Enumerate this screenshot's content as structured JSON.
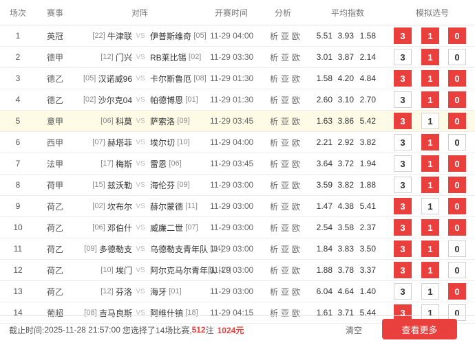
{
  "headers": {
    "num": "场次",
    "league": "赛事",
    "match": "对阵",
    "time": "开赛时间",
    "analysis": "分析",
    "odds": "平均指数",
    "sim": "模拟选号"
  },
  "analysis_links": [
    "析",
    "亚",
    "欧"
  ],
  "vs_label": "VS",
  "matches": [
    {
      "num": "1",
      "league": "英冠",
      "home_rank": "[22]",
      "home": "牛津联",
      "away": "伊普斯维奇",
      "away_rank": "[05]",
      "time": "11-29 04:00",
      "odds": [
        "5.51",
        "3.93",
        "1.58"
      ],
      "sel3": true,
      "sel1": true,
      "sel0": true
    },
    {
      "num": "2",
      "league": "德甲",
      "home_rank": "[12]",
      "home": "门兴",
      "away": "RB莱比锡",
      "away_rank": "[02]",
      "time": "11-29 03:30",
      "odds": [
        "3.01",
        "3.87",
        "2.14"
      ],
      "sel3": false,
      "sel1": true,
      "sel0": false
    },
    {
      "num": "3",
      "league": "德乙",
      "home_rank": "[05]",
      "home": "汉诺威96",
      "away": "卡尔斯鲁厄",
      "away_rank": "[08]",
      "time": "11-29 01:30",
      "odds": [
        "1.58",
        "4.20",
        "4.84"
      ],
      "sel3": true,
      "sel1": true,
      "sel0": true
    },
    {
      "num": "4",
      "league": "德乙",
      "home_rank": "[02]",
      "home": "沙尔克04",
      "away": "帕德博恩",
      "away_rank": "[01]",
      "time": "11-29 01:30",
      "odds": [
        "2.60",
        "3.10",
        "2.70"
      ],
      "sel3": false,
      "sel1": true,
      "sel0": true
    },
    {
      "num": "5",
      "league": "意甲",
      "home_rank": "[06]",
      "home": "科莫",
      "away": "萨索洛",
      "away_rank": "[09]",
      "time": "11-29 03:45",
      "odds": [
        "1.63",
        "3.86",
        "5.42"
      ],
      "sel3": true,
      "sel1": false,
      "sel0": true
    },
    {
      "num": "6",
      "league": "西甲",
      "home_rank": "[07]",
      "home": "赫塔菲",
      "away": "埃尔切",
      "away_rank": "[10]",
      "time": "11-29 04:00",
      "odds": [
        "2.21",
        "2.92",
        "3.82"
      ],
      "sel3": false,
      "sel1": true,
      "sel0": false
    },
    {
      "num": "7",
      "league": "法甲",
      "home_rank": "[17]",
      "home": "梅斯",
      "away": "雷恩",
      "away_rank": "[06]",
      "time": "11-29 03:45",
      "odds": [
        "3.64",
        "3.72",
        "1.94"
      ],
      "sel3": false,
      "sel1": true,
      "sel0": true
    },
    {
      "num": "8",
      "league": "荷甲",
      "home_rank": "[15]",
      "home": "兹沃勒",
      "away": "海伦芬",
      "away_rank": "[09]",
      "time": "11-29 03:00",
      "odds": [
        "3.59",
        "3.82",
        "1.88"
      ],
      "sel3": false,
      "sel1": true,
      "sel0": true
    },
    {
      "num": "9",
      "league": "荷乙",
      "home_rank": "[02]",
      "home": "坎布尔",
      "away": "赫尔蒙德",
      "away_rank": "[11]",
      "time": "11-29 03:00",
      "odds": [
        "1.47",
        "4.38",
        "5.41"
      ],
      "sel3": true,
      "sel1": false,
      "sel0": true
    },
    {
      "num": "10",
      "league": "荷乙",
      "home_rank": "[06]",
      "home": "邓伯什",
      "away": "威廉二世",
      "away_rank": "[07]",
      "time": "11-29 03:00",
      "odds": [
        "2.54",
        "3.58",
        "2.37"
      ],
      "sel3": true,
      "sel1": true,
      "sel0": true
    },
    {
      "num": "11",
      "league": "荷乙",
      "home_rank": "[09]",
      "home": "多德勒支",
      "away": "乌德勒支青年队",
      "away_rank": "[14]",
      "time": "11-29 03:00",
      "odds": [
        "1.84",
        "3.83",
        "3.50"
      ],
      "sel3": true,
      "sel1": true,
      "sel0": false
    },
    {
      "num": "12",
      "league": "荷乙",
      "home_rank": "[10]",
      "home": "埃门",
      "away": "阿尔克马尔青年队",
      "away_rank": "[17]",
      "time": "11-29 03:00",
      "odds": [
        "1.88",
        "3.78",
        "3.37"
      ],
      "sel3": true,
      "sel1": true,
      "sel0": false
    },
    {
      "num": "13",
      "league": "荷乙",
      "home_rank": "[12]",
      "home": "芬洛",
      "away": "海牙",
      "away_rank": "[01]",
      "time": "11-29 03:00",
      "odds": [
        "6.04",
        "4.64",
        "1.40"
      ],
      "sel3": false,
      "sel1": false,
      "sel0": true
    },
    {
      "num": "14",
      "league": "葡超",
      "home_rank": "[08]",
      "home": "吉马良斯",
      "away": "阿维什镇",
      "away_rank": "[18]",
      "time": "11-29 04:15",
      "odds": [
        "1.61",
        "3.71",
        "5.44"
      ],
      "sel3": true,
      "sel1": false,
      "sel0": false
    }
  ],
  "highlight_row": "5",
  "footer": {
    "deadline_prefix": "截止时间:",
    "deadline": "2025-11-28 21:57:00",
    "selected_text": "您选择了14场比赛,",
    "bets": "512",
    "bets_unit": "注",
    "amount": "1024元",
    "clear_label": "清空",
    "more_label": "查看更多"
  },
  "colors": {
    "accent": "#e9403e",
    "highlight": "#fdfbe6"
  }
}
